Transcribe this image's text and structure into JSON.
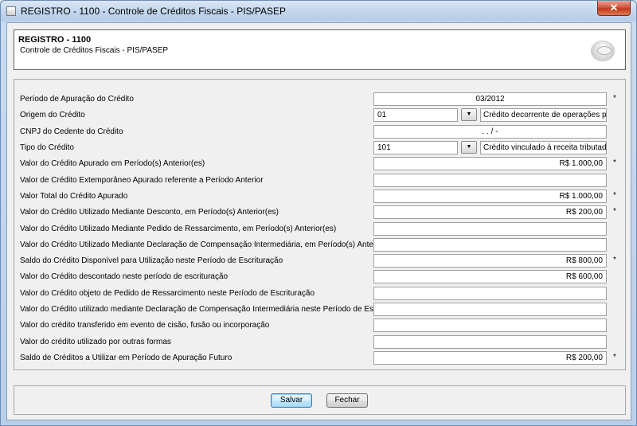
{
  "window": {
    "title": "REGISTRO - 1100 - Controle de Créditos Fiscais - PIS/PASEP",
    "close_label": "✕"
  },
  "header": {
    "title": "REGISTRO - 1100",
    "subtitle": "Controle de Créditos Fiscais - PIS/PASEP",
    "icon": "database-icon"
  },
  "form": {
    "rows": [
      {
        "label": "Período de Apuração do Crédito",
        "value": "03/2012",
        "required": "*"
      },
      {
        "label": "Origem do Crédito",
        "code": "01",
        "description": "Crédito decorrente de operações própr",
        "required": ""
      },
      {
        "label": "CNPJ do Cedente do Crédito",
        "value": ".   .   /   -",
        "required": ""
      },
      {
        "label": "Tipo do Crédito",
        "code": "101",
        "description": "Crédito vinculado à receita tributada n",
        "required": ""
      },
      {
        "label": "Valor do Crédito Apurado em Período(s) Anterior(es)",
        "value": "R$ 1.000,00",
        "required": "*"
      },
      {
        "label": "Valor de Crédito Extemporâneo Apurado referente a Período Anterior",
        "value": "",
        "required": ""
      },
      {
        "label": "Valor Total do Crédito Apurado",
        "value": "R$ 1.000,00",
        "required": "*"
      },
      {
        "label": "Valor do Crédito Utilizado Mediante Desconto, em Período(s) Anterior(es)",
        "value": "R$ 200,00",
        "required": "*"
      },
      {
        "label": "Valor do Crédito Utilizado Mediante Pedido de Ressarcimento, em Período(s) Anterior(es)",
        "value": "",
        "required": ""
      },
      {
        "label": "Valor do Crédito Utilizado Mediante Declaração de Compensação Intermediária, em Período(s) Anterior(es)",
        "value": "",
        "required": ""
      },
      {
        "label": "Saldo do Crédito Disponível para Utilização neste Período de Escrituração",
        "value": "R$ 800,00",
        "required": "*"
      },
      {
        "label": "Valor do Crédito descontado neste período de escrituração",
        "value": "R$ 600,00",
        "required": ""
      },
      {
        "label": "Valor do Crédito objeto de Pedido de Ressarcimento neste Período de Escrituração",
        "value": "",
        "required": ""
      },
      {
        "label": "Valor do Crédito utilizado mediante Declaração de Compensação Intermediária neste Período de Escrituração",
        "value": "",
        "required": ""
      },
      {
        "label": "Valor do crédito transferido em evento de cisão, fusão ou incorporação",
        "value": "",
        "required": ""
      },
      {
        "label": "Valor do crédito utilizado por outras formas",
        "value": "",
        "required": ""
      },
      {
        "label": "Saldo de Créditos a Utilizar em Período de Apuração Futuro",
        "value": "R$ 200,00",
        "required": "*"
      }
    ],
    "dropdown_glyph": "▼"
  },
  "buttons": {
    "save": "Salvar",
    "close": "Fechar"
  }
}
